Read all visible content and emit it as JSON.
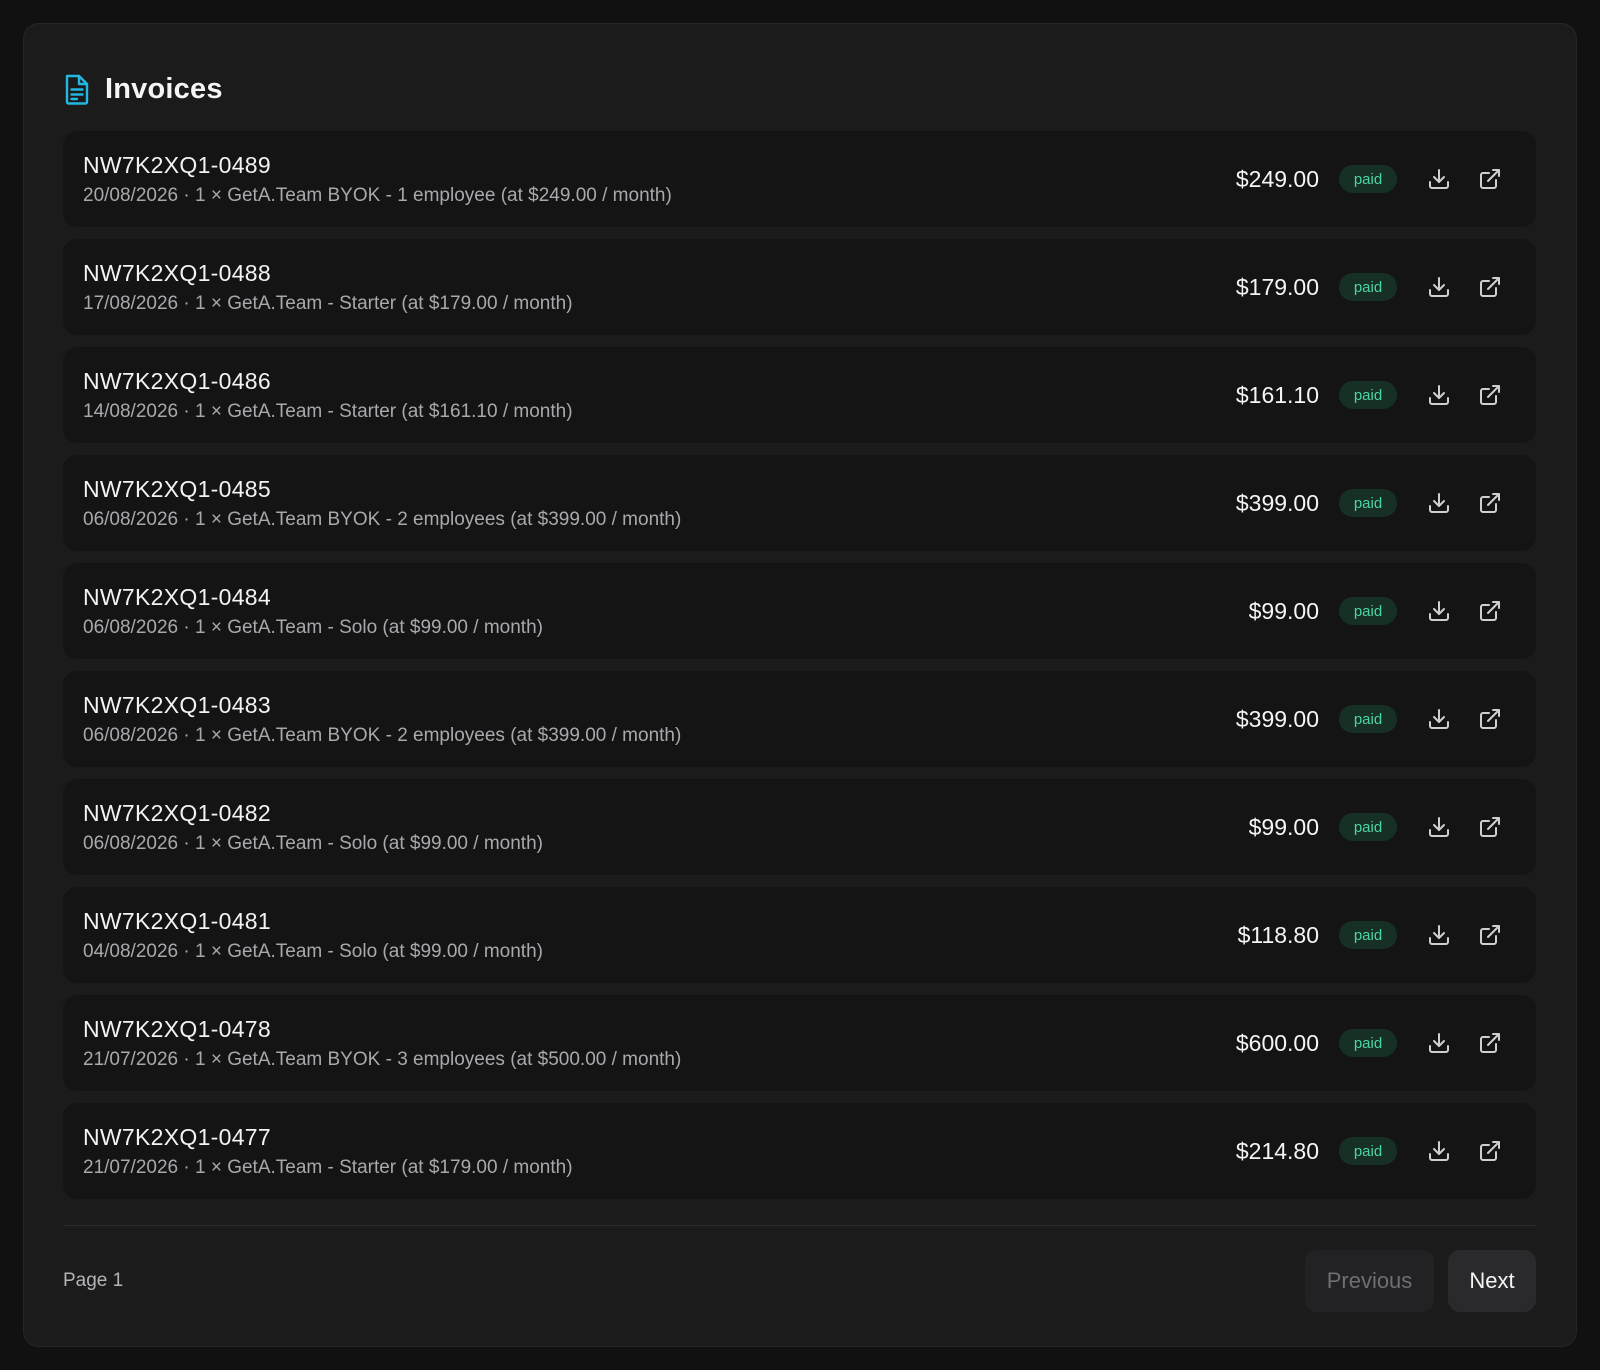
{
  "header": {
    "title": "Invoices",
    "icon": "document-icon",
    "accent": "#22b8e0"
  },
  "invoices": [
    {
      "id": "NW7K2XQ1-0489",
      "desc": "20/08/2026 · 1 × GetA.Team BYOK - 1 employee (at $249.00 / month)",
      "amount": "$249.00",
      "status": "paid"
    },
    {
      "id": "NW7K2XQ1-0488",
      "desc": "17/08/2026 · 1 × GetA.Team - Starter (at $179.00 / month)",
      "amount": "$179.00",
      "status": "paid"
    },
    {
      "id": "NW7K2XQ1-0486",
      "desc": "14/08/2026 · 1 × GetA.Team - Starter (at $161.10 / month)",
      "amount": "$161.10",
      "status": "paid"
    },
    {
      "id": "NW7K2XQ1-0485",
      "desc": "06/08/2026 · 1 × GetA.Team BYOK - 2 employees (at $399.00 / month)",
      "amount": "$399.00",
      "status": "paid"
    },
    {
      "id": "NW7K2XQ1-0484",
      "desc": "06/08/2026 · 1 × GetA.Team - Solo (at $99.00 / month)",
      "amount": "$99.00",
      "status": "paid"
    },
    {
      "id": "NW7K2XQ1-0483",
      "desc": "06/08/2026 · 1 × GetA.Team BYOK - 2 employees (at $399.00 / month)",
      "amount": "$399.00",
      "status": "paid"
    },
    {
      "id": "NW7K2XQ1-0482",
      "desc": "06/08/2026 · 1 × GetA.Team - Solo (at $99.00 / month)",
      "amount": "$99.00",
      "status": "paid"
    },
    {
      "id": "NW7K2XQ1-0481",
      "desc": "04/08/2026 · 1 × GetA.Team - Solo (at $99.00 / month)",
      "amount": "$118.80",
      "status": "paid"
    },
    {
      "id": "NW7K2XQ1-0478",
      "desc": "21/07/2026 · 1 × GetA.Team BYOK - 3 employees (at $500.00 / month)",
      "amount": "$600.00",
      "status": "paid"
    },
    {
      "id": "NW7K2XQ1-0477",
      "desc": "21/07/2026 · 1 × GetA.Team - Starter (at $179.00 / month)",
      "amount": "$214.80",
      "status": "paid"
    }
  ],
  "row_icons": {
    "download": "download-icon",
    "open": "external-link-icon"
  },
  "pagination": {
    "page_label": "Page 1",
    "previous_label": "Previous",
    "next_label": "Next"
  },
  "colors": {
    "badge_bg": "#163026",
    "badge_text": "#4ed5a2"
  }
}
